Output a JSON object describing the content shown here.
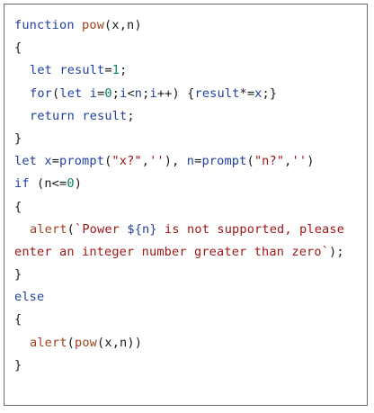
{
  "code": {
    "lines": [
      "function pow(x,n)",
      "{",
      "  let result=1;",
      "  for(let i=0;i<n;i++) {result*=x;}",
      "  return result;",
      "}",
      "let x=prompt(\"x?\",''), n=prompt(\"n?\",'')",
      "if (n<=0)",
      "{",
      "  alert(`Power ${n} is not supported, please",
      "enter an integer number greater than zero`);",
      "}",
      "else",
      "{",
      "  alert(pow(x,n))",
      "}"
    ]
  },
  "tokens": {
    "l1": [
      "function",
      "pow",
      "(x,n)"
    ],
    "l2": [
      "{"
    ],
    "l3": [
      "let",
      "result",
      "=",
      "1",
      ";"
    ],
    "l4": [
      "for",
      "(",
      "let",
      "i",
      "=",
      "0",
      ";",
      "i",
      "<",
      "n",
      ";",
      "i",
      "++) {",
      "result",
      "*=",
      "x",
      ";}"
    ],
    "l5": [
      "return",
      "result",
      ";"
    ],
    "l6": [
      "}"
    ],
    "l7": [
      "let",
      "x",
      "=",
      "prompt",
      "(",
      "\"x?\"",
      ",",
      "''",
      "), ",
      "n",
      "=",
      "prompt",
      "(",
      "\"n?\"",
      ",",
      "''",
      ")"
    ],
    "l8": [
      "if",
      "(n<=",
      "0",
      ")"
    ],
    "l9": [
      "{"
    ],
    "l10": [
      "alert",
      "(",
      "`Power ",
      "${n}",
      " is not supported, please"
    ],
    "l11": [
      "enter an integer number greater than zero`",
      ");"
    ],
    "l12": [
      "}"
    ],
    "l13": [
      "else"
    ],
    "l14": [
      "{"
    ],
    "l15": [
      "alert",
      "(",
      "pow",
      "(x,n))"
    ],
    "l16": [
      "}"
    ]
  },
  "colors": {
    "keyword": "#1f3fa6",
    "string": "#a31515",
    "number": "#098658",
    "function_name": "#a3411a",
    "border": "#6b6b6b"
  }
}
